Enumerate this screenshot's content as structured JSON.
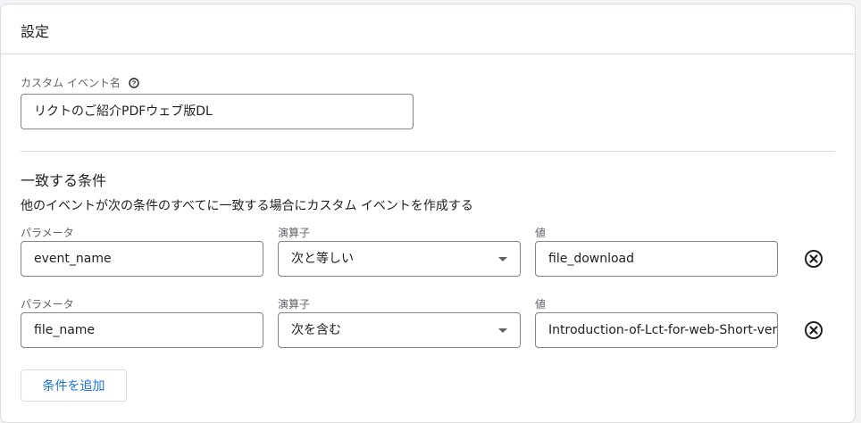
{
  "header": {
    "title": "設定"
  },
  "custom_event": {
    "label": "カスタム イベント名",
    "help_icon": "help-circle-icon",
    "value": "リクトのご紹介PDFウェブ版DL"
  },
  "conditions": {
    "title": "一致する条件",
    "description": "他のイベントが次の条件のすべてに一致する場合にカスタム イベントを作成する",
    "rows": [
      {
        "param_label": "パラメータ",
        "param_value": "event_name",
        "operator_label": "演算子",
        "operator_value": "次と等しい",
        "value_label": "値",
        "value_value": "file_download"
      },
      {
        "param_label": "パラメータ",
        "param_value": "file_name",
        "operator_label": "演算子",
        "operator_value": "次を含む",
        "value_label": "値",
        "value_value": "Introduction-of-Lct-for-web-Short-vers"
      }
    ],
    "remove_icon": "close-circle-icon",
    "add_button_label": "条件を追加"
  },
  "colors": {
    "accent": "#1a73e8",
    "border": "#dadce0",
    "text": "#202124",
    "muted": "#5f6368"
  }
}
